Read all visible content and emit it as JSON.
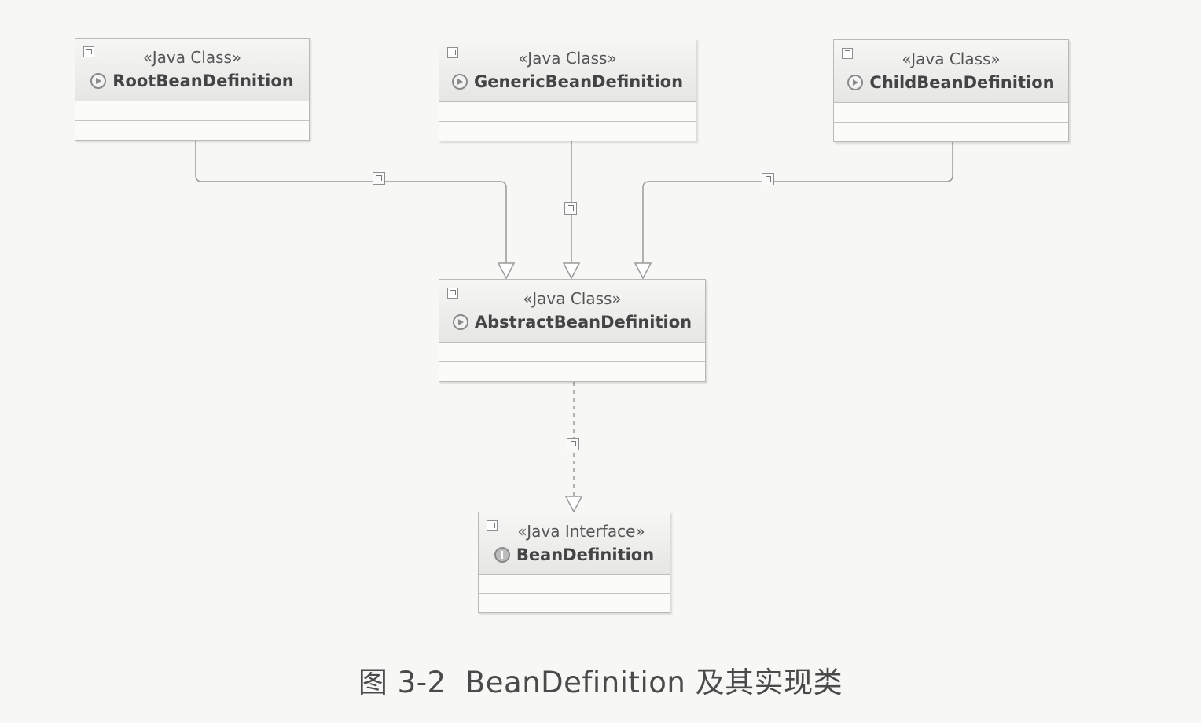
{
  "classes": {
    "root": {
      "stereotype": "«Java Class»",
      "name": "RootBeanDefinition"
    },
    "generic": {
      "stereotype": "«Java Class»",
      "name": "GenericBeanDefinition"
    },
    "child": {
      "stereotype": "«Java Class»",
      "name": "ChildBeanDefinition"
    },
    "abstract": {
      "stereotype": "«Java Class»",
      "name": "AbstractBeanDefinition"
    },
    "iface": {
      "stereotype": "«Java Interface»",
      "name": "BeanDefinition"
    }
  },
  "relations": [
    {
      "from": "RootBeanDefinition",
      "to": "AbstractBeanDefinition",
      "kind": "generalization"
    },
    {
      "from": "GenericBeanDefinition",
      "to": "AbstractBeanDefinition",
      "kind": "generalization"
    },
    {
      "from": "ChildBeanDefinition",
      "to": "AbstractBeanDefinition",
      "kind": "generalization"
    },
    {
      "from": "AbstractBeanDefinition",
      "to": "BeanDefinition",
      "kind": "realization"
    }
  ],
  "caption": {
    "figure_number": "图 3-2",
    "text": "BeanDefinition 及其实现类"
  },
  "colors": {
    "line": "#9a9a9a",
    "box_border": "#b9b9b9",
    "background": "#f7f7f5"
  }
}
